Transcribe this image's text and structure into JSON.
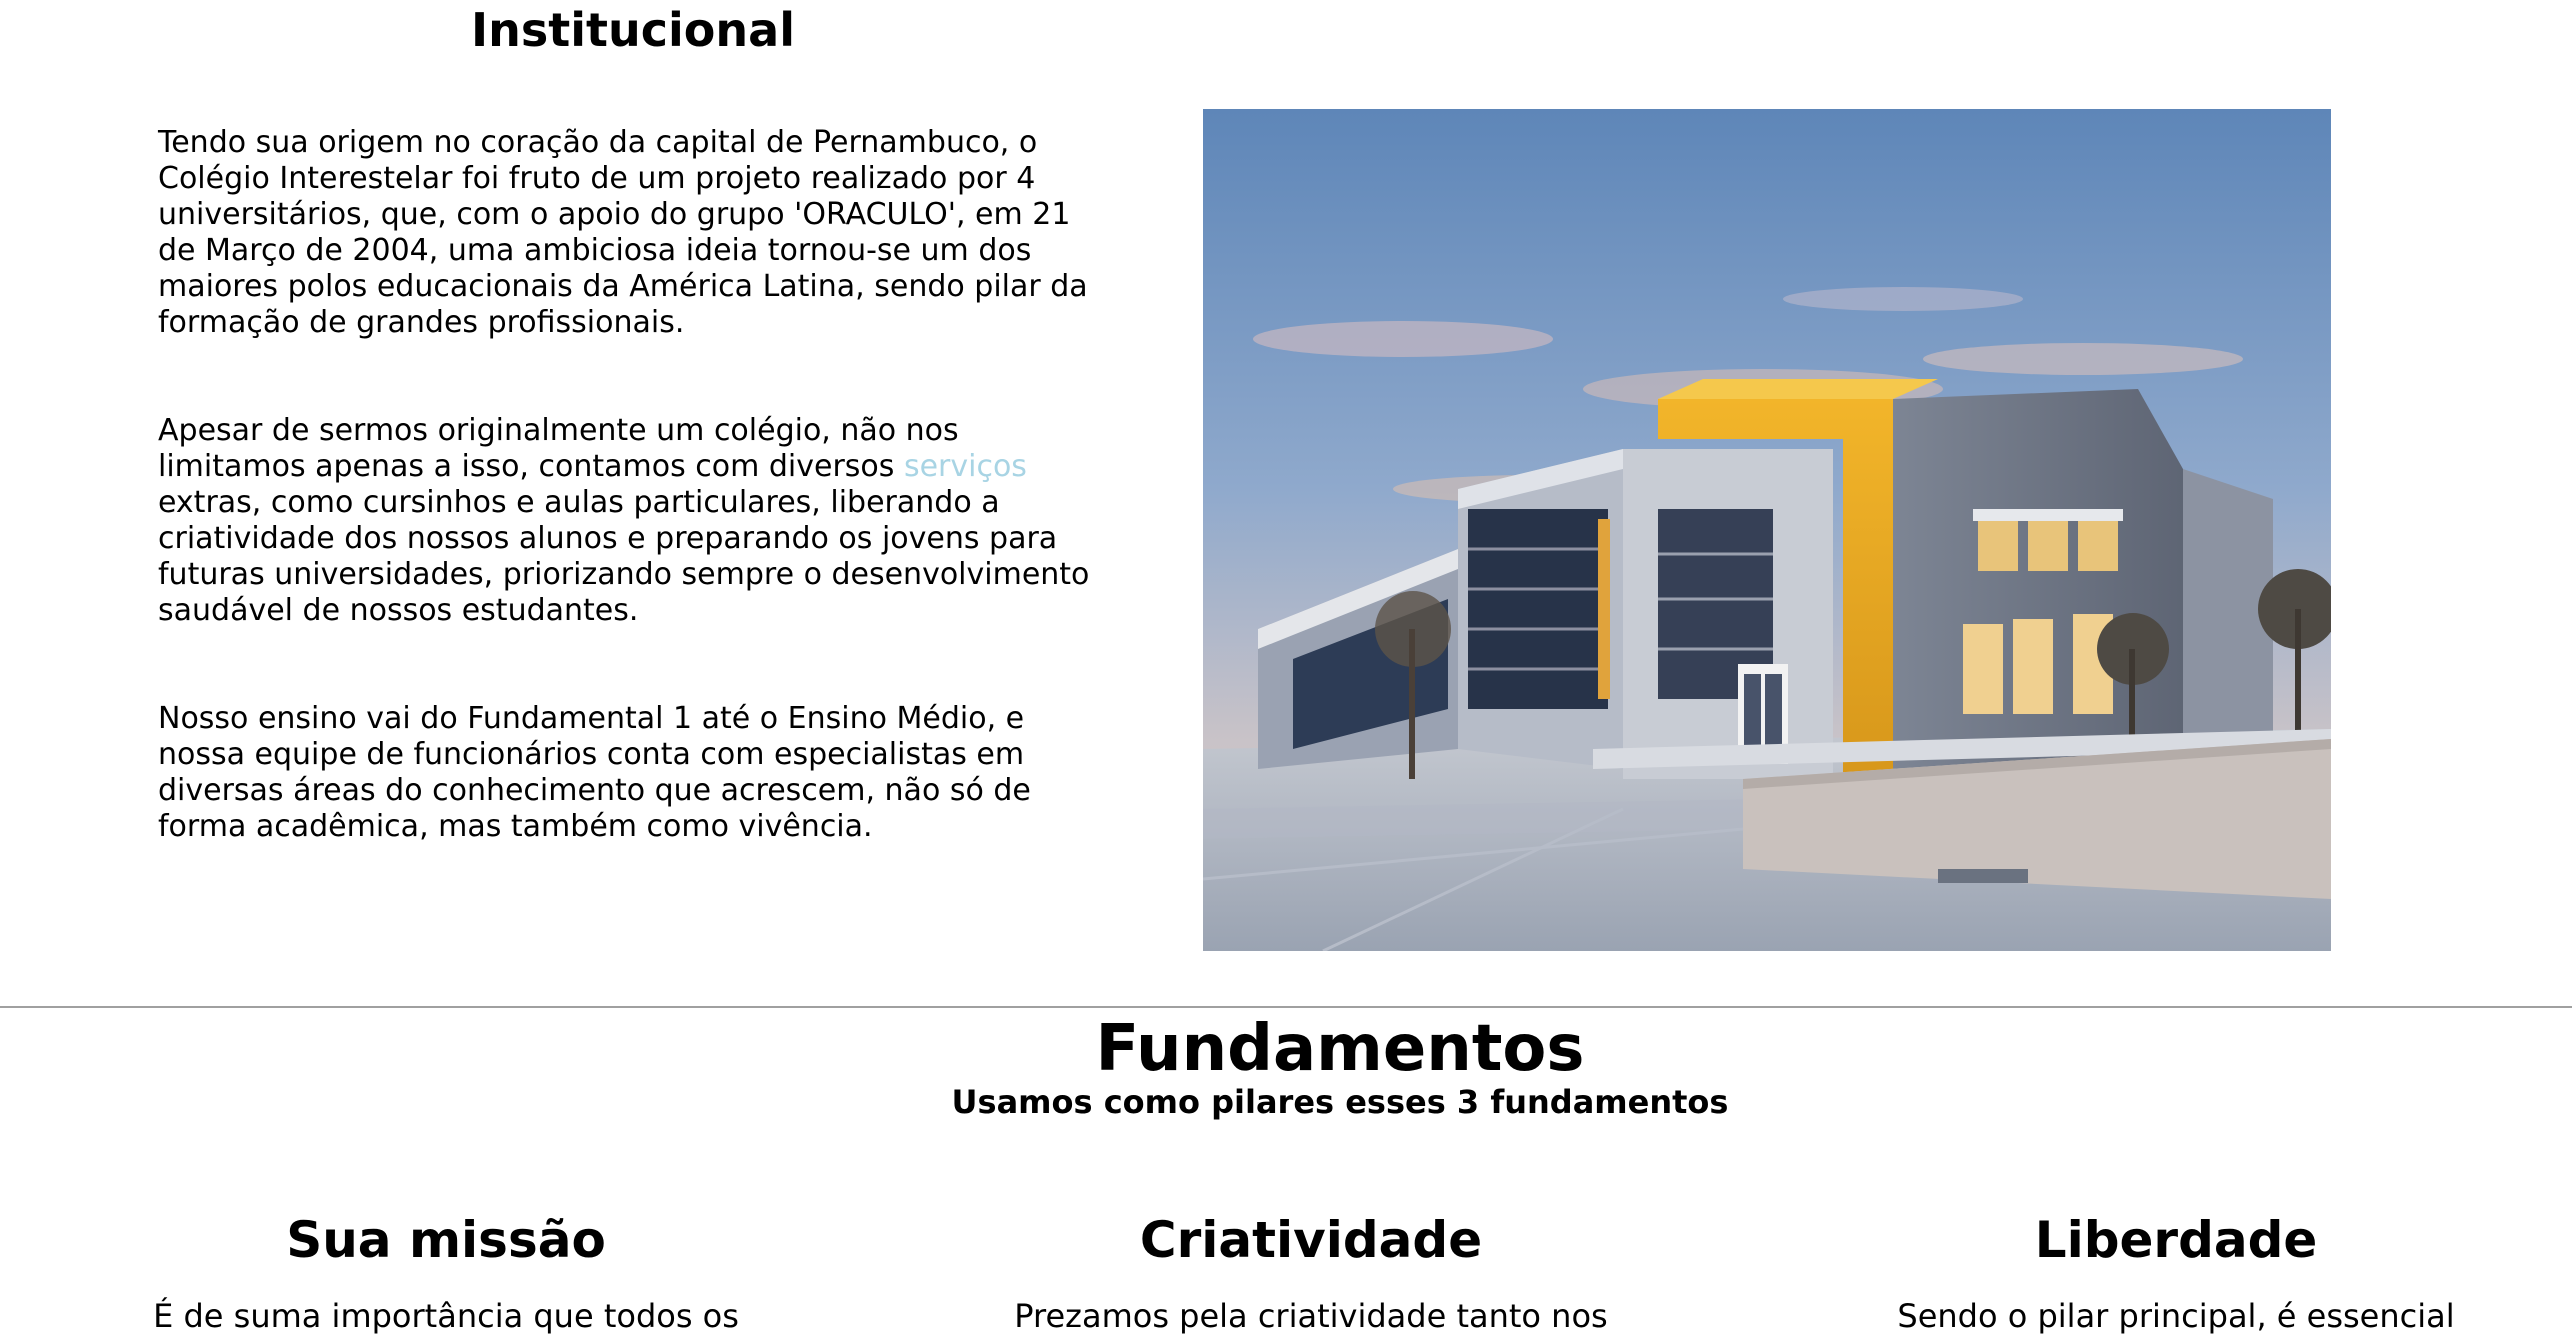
{
  "institucional": {
    "title": "Institucional",
    "paragraph1": "Tendo sua origem no coração da capital de Pernambuco, o Colégio Interestelar foi fruto de um projeto realizado por 4 universitários, que, com o apoio do grupo 'ORACULO', em 21 de Março de 2004, uma ambiciosa ideia tornou-se um dos maiores polos educacionais da América Latina, sendo pilar da formação de grandes profissionais.",
    "paragraph2_before": "Apesar de sermos originalmente um colégio, não nos limitamos apenas a isso, contamos com diversos ",
    "paragraph2_link": "serviços",
    "paragraph2_after": " extras, como cursinhos e aulas particulares, liberando a criatividade dos nossos alunos e preparando os jovens para futuras universidades, priorizando sempre o desenvolvimento saudável de nossos estudantes.",
    "paragraph3": "Nosso ensino vai do Fundamental 1 até o Ensino Médio, e nossa equipe de funcionários conta com especialistas em diversas áreas do conhecimento que acrescem, não só de forma acadêmica, mas também como vivência.",
    "link_color": "#a8d4e4"
  },
  "fundamentos": {
    "title": "Fundamentos",
    "subtitle": "Usamos como pilares esses 3 fundamentos",
    "pillars": [
      {
        "title": "Sua missão",
        "text": "É de suma importância que todos os"
      },
      {
        "title": "Criatividade",
        "text": "Prezamos pela criatividade tanto nos"
      },
      {
        "title": "Liberdade",
        "text": "Sendo o pilar principal, é essencial"
      }
    ]
  },
  "colors": {
    "divider": "#a0a0a0",
    "background": "#ffffff",
    "text": "#000000"
  }
}
